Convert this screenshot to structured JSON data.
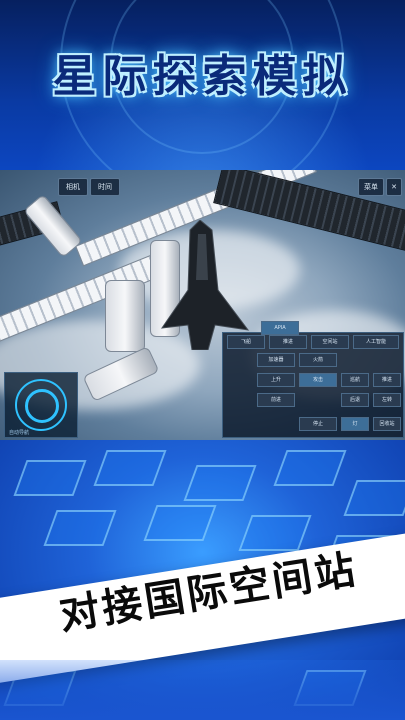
{
  "banner": {
    "title": "星际探索模拟"
  },
  "screen": {
    "top_buttons": [
      "相机",
      "时间"
    ],
    "settings_label": "菜单",
    "radar_label": "自动导航",
    "panel": {
      "header": "APIA",
      "row1": [
        "飞船",
        "推进",
        "空间站",
        "人工智能"
      ],
      "row2": [
        "加速器",
        "火箭"
      ],
      "row3": [
        "上升",
        "攻击",
        "巡航",
        "推进"
      ],
      "row4": [
        "前进",
        "后退",
        "左转"
      ],
      "row5": [
        "停止",
        "灯",
        "回收站"
      ]
    }
  },
  "ribbon": {
    "text": "对接国际空间站"
  },
  "colors": {
    "accent": "#2fc2ff",
    "banner": "#0a3aa3"
  }
}
